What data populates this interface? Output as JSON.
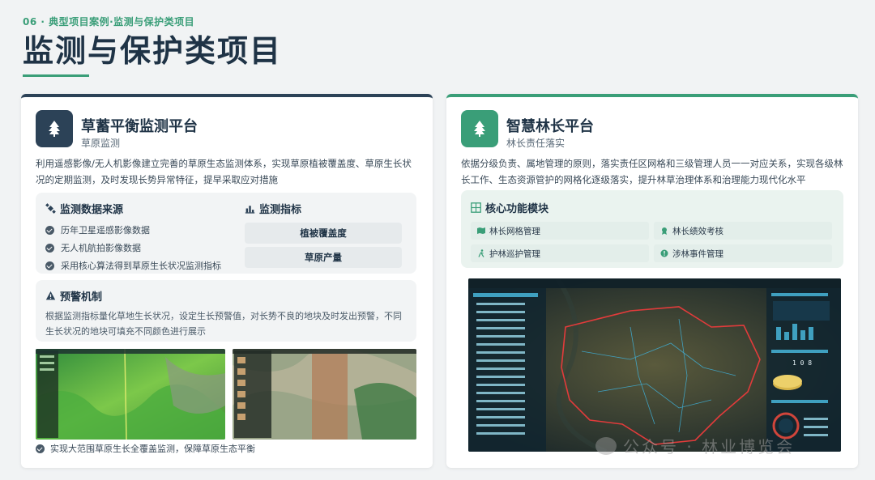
{
  "header": {
    "section": "06 · 典型项目案例·监测与保护类项目",
    "title": "监测与保护类项目"
  },
  "left_card": {
    "title": "草蓄平衡监测平台",
    "subtitle": "草原监测",
    "description": "利用遥感影像/无人机影像建立完善的草原生态监测体系，实现草原植被覆盖度、草原生长状况的定期监测，及时发现长势异常特征，提早采取应对措施",
    "sources": {
      "heading": "监测数据来源",
      "items": [
        "历年卫星遥感影像数据",
        "无人机航拍影像数据",
        "采用核心算法得到草原生长状况监测指标"
      ]
    },
    "metrics": {
      "heading": "监测指标",
      "items": [
        "植被覆盖度",
        "草原产量"
      ]
    },
    "warning": {
      "heading": "预警机制",
      "text": "根据监测指标量化草地生长状况，设定生长预警值，对长势不良的地块及时发出预警，不同生长状况的地块可填充不同颜色进行展示"
    },
    "caption": "实现大范围草原生长全覆盖监测，保障草原生态平衡"
  },
  "right_card": {
    "title": "智慧林长平台",
    "subtitle": "林长责任落实",
    "description": "依据分级负责、属地管理的原则，落实责任区网格和三级管理人员一一对应关系，实现各级林长工作、生态资源管护的网格化逐级落实，提升林草治理体系和治理能力现代化水平",
    "modules": {
      "heading": "核心功能模块",
      "items": [
        "林长网格管理",
        "林长绩效考核",
        "护林巡护管理",
        "涉林事件管理"
      ]
    },
    "dashboard": {
      "counter": "1 0 8"
    }
  },
  "watermark": "公众号 · 林业博览会",
  "colors": {
    "accent": "#3a9e78",
    "dark": "#2c4257"
  }
}
